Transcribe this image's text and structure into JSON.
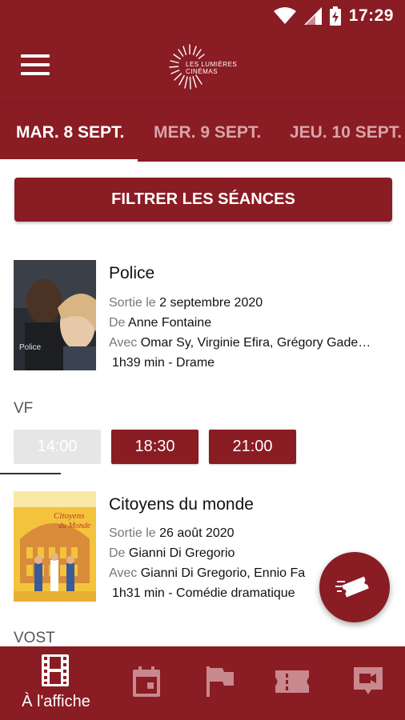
{
  "status_bar": {
    "time": "17:29",
    "icons": [
      "wifi-icon",
      "signal-icon",
      "battery-charging-icon"
    ]
  },
  "app_bar": {
    "menu_icon": "hamburger-menu-icon",
    "logo": {
      "line1": "LES LUMIÈRES",
      "line2": "CINÉMAS"
    }
  },
  "dates": [
    {
      "label": "MAR. 8 SEPT.",
      "selected": true
    },
    {
      "label": "MER. 9 SEPT.",
      "selected": false
    },
    {
      "label": "JEU. 10 SEPT.",
      "selected": false
    }
  ],
  "filter_button": "FILTRER LES SÉANCES",
  "movies": [
    {
      "title": "Police",
      "release_prefix": "Sortie le",
      "release_date": "2 septembre 2020",
      "director_prefix": "De",
      "director": "Anne Fontaine",
      "cast_prefix": "Avec",
      "cast": "Omar Sy, Virginie Efira, Grégory Gade…",
      "duration_genre": "1h39 min - Drame",
      "poster_text": "Police",
      "showtime_groups": [
        {
          "language": "VF",
          "times": [
            {
              "time": "14:00",
              "available": false
            },
            {
              "time": "18:30",
              "available": true
            },
            {
              "time": "21:00",
              "available": true
            }
          ]
        }
      ]
    },
    {
      "title": "Citoyens du monde",
      "release_prefix": "Sortie le",
      "release_date": "26 août 2020",
      "director_prefix": "De",
      "director": "Gianni Di Gregorio",
      "cast_prefix": "Avec",
      "cast": "Gianni Di Gregorio, Ennio Fa",
      "duration_genre": "1h31 min - Comédie dramatique",
      "poster_text_1": "Citoyens",
      "poster_text_2": "du Monde",
      "showtime_groups": [
        {
          "language": "VOST",
          "times": []
        }
      ]
    }
  ],
  "fab_icon": "ticket-fast-icon",
  "bottom_nav": [
    {
      "icon": "film-strip-icon",
      "label": "À l'affiche",
      "active": true
    },
    {
      "icon": "calendar-icon",
      "label": "",
      "active": false
    },
    {
      "icon": "flag-icon",
      "label": "",
      "active": false
    },
    {
      "icon": "ticket-icon",
      "label": "",
      "active": false
    },
    {
      "icon": "video-call-icon",
      "label": "",
      "active": false
    }
  ],
  "colors": {
    "primary": "#8a1c24",
    "inactive_tab": "#d9a4a8",
    "past_session": "#e6e6e6"
  }
}
